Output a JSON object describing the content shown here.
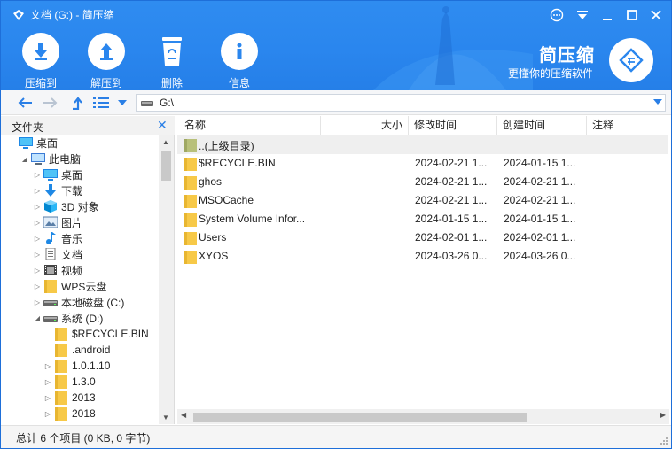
{
  "window": {
    "title": "文档 (G:) - 简压缩"
  },
  "toolbar": {
    "compress_label": "压缩到",
    "extract_label": "解压到",
    "delete_label": "删除",
    "info_label": "信息"
  },
  "brand": {
    "name": "简压缩",
    "slogan": "更懂你的压缩软件"
  },
  "nav": {
    "path": "G:\\"
  },
  "left_panel": {
    "title": "文件夹",
    "tree": [
      {
        "label": "桌面",
        "icon": "desktop-icon",
        "level": 0,
        "arrow": ""
      },
      {
        "label": "此电脑",
        "icon": "computer-icon",
        "level": 1,
        "arrow": "expanded"
      },
      {
        "label": "桌面",
        "icon": "desktop-icon",
        "level": 2,
        "arrow": "collapsed"
      },
      {
        "label": "下载",
        "icon": "download-icon",
        "level": 2,
        "arrow": "collapsed"
      },
      {
        "label": "3D 对象",
        "icon": "cube-icon",
        "level": 2,
        "arrow": "collapsed"
      },
      {
        "label": "图片",
        "icon": "picture-icon",
        "level": 2,
        "arrow": "collapsed"
      },
      {
        "label": "音乐",
        "icon": "music-icon",
        "level": 2,
        "arrow": "collapsed"
      },
      {
        "label": "文档",
        "icon": "document-icon",
        "level": 2,
        "arrow": "collapsed"
      },
      {
        "label": "视频",
        "icon": "video-icon",
        "level": 2,
        "arrow": "collapsed"
      },
      {
        "label": "WPS云盘",
        "icon": "folder-icon",
        "level": 2,
        "arrow": "collapsed"
      },
      {
        "label": "本地磁盘 (C:)",
        "icon": "drive-icon",
        "level": 2,
        "arrow": "collapsed"
      },
      {
        "label": "系统 (D:)",
        "icon": "drive-icon",
        "level": 2,
        "arrow": "expanded"
      },
      {
        "label": "$RECYCLE.BIN",
        "icon": "folder-icon",
        "level": 3,
        "arrow": ""
      },
      {
        "label": ".android",
        "icon": "folder-icon",
        "level": 3,
        "arrow": ""
      },
      {
        "label": "1.0.1.10",
        "icon": "folder-icon",
        "level": 3,
        "arrow": "collapsed"
      },
      {
        "label": "1.3.0",
        "icon": "folder-icon",
        "level": 3,
        "arrow": "collapsed"
      },
      {
        "label": "2013",
        "icon": "folder-icon",
        "level": 3,
        "arrow": "collapsed"
      },
      {
        "label": "2018",
        "icon": "folder-icon",
        "level": 3,
        "arrow": "collapsed"
      }
    ]
  },
  "file_list": {
    "columns": {
      "name": "名称",
      "size": "大小",
      "modified": "修改时间",
      "created": "创建时间",
      "comment": "注释"
    },
    "rows": [
      {
        "name": "..(上级目录)",
        "modified": "",
        "created": "",
        "icon": "parent-folder-icon"
      },
      {
        "name": "$RECYCLE.BIN",
        "modified": "2024-02-21 1...",
        "created": "2024-01-15 1...",
        "icon": "folder-icon"
      },
      {
        "name": "ghos",
        "modified": "2024-02-21 1...",
        "created": "2024-02-21 1...",
        "icon": "folder-icon"
      },
      {
        "name": "MSOCache",
        "modified": "2024-02-21 1...",
        "created": "2024-02-21 1...",
        "icon": "folder-icon"
      },
      {
        "name": "System Volume Infor...",
        "modified": "2024-01-15 1...",
        "created": "2024-01-15 1...",
        "icon": "folder-icon"
      },
      {
        "name": "Users",
        "modified": "2024-02-01 1...",
        "created": "2024-02-01 1...",
        "icon": "folder-icon"
      },
      {
        "name": "XYOS",
        "modified": "2024-03-26 0...",
        "created": "2024-03-26 0...",
        "icon": "folder-icon"
      }
    ]
  },
  "status": {
    "text": "总计 6 个项目 (0 KB, 0 字节)"
  },
  "colors": {
    "accent": "#2a86ee",
    "folder": "#f7c948",
    "arrow_blue": "#2a7fe6"
  }
}
